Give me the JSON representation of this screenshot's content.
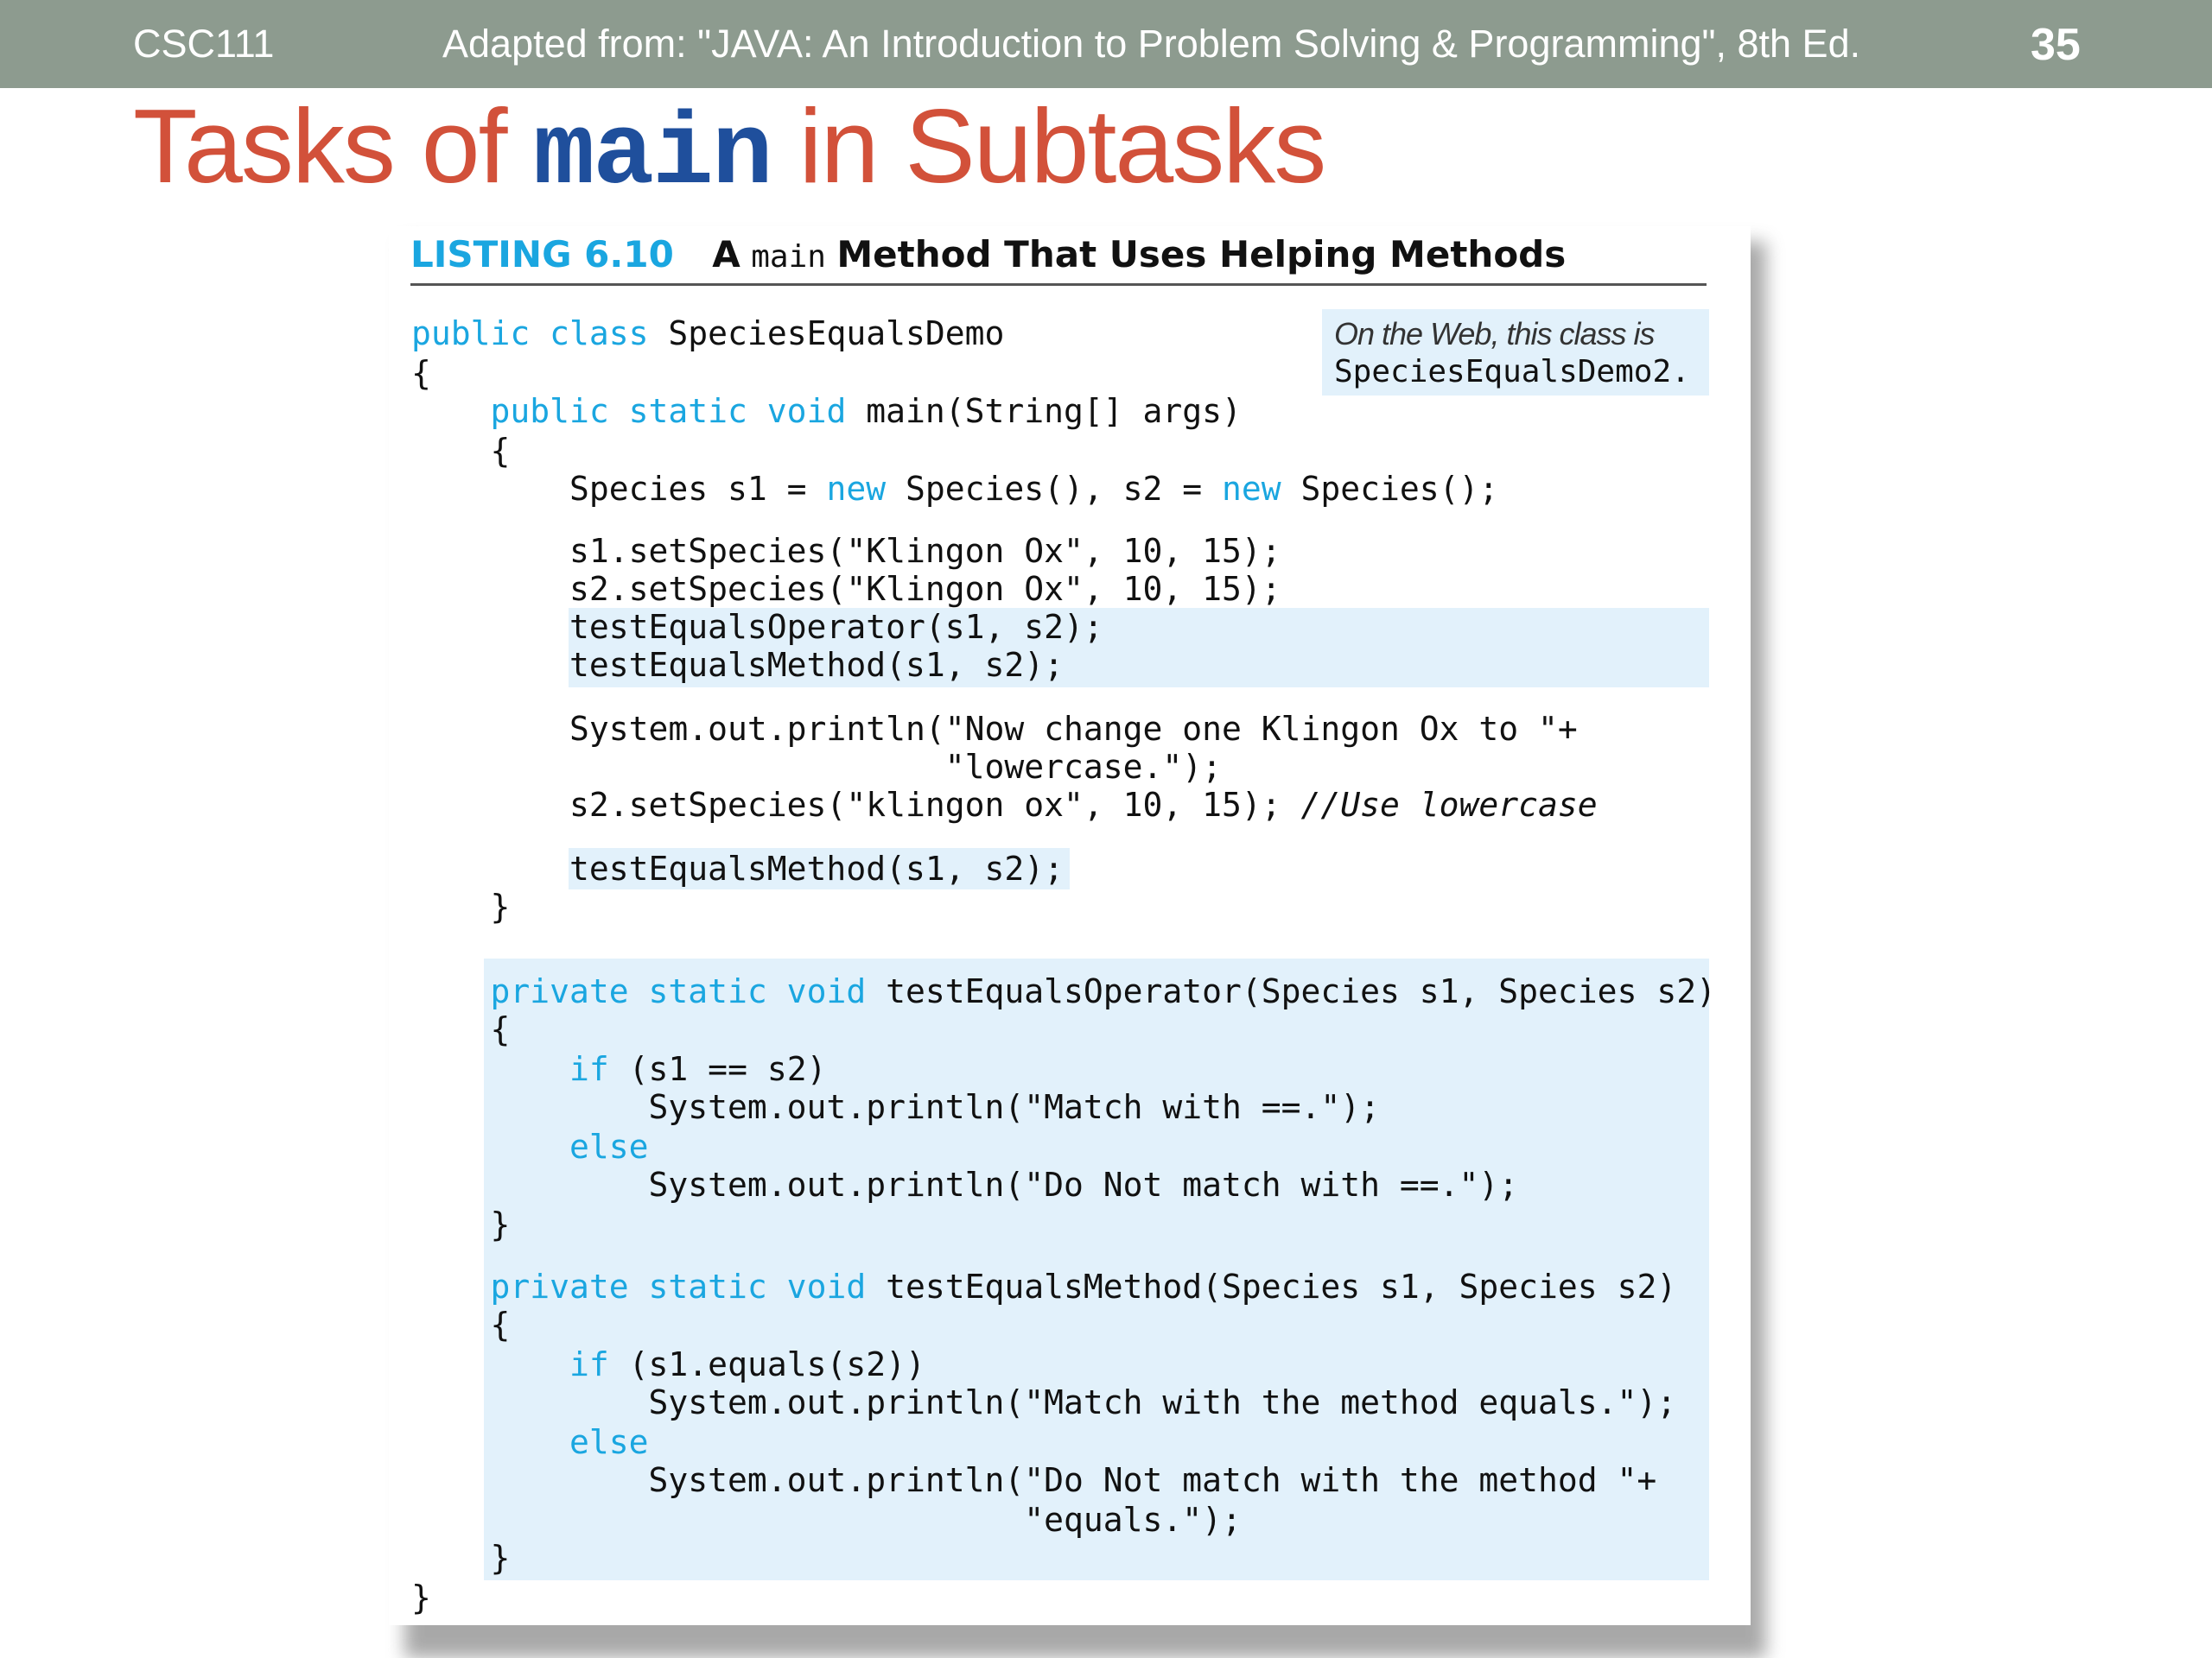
{
  "header": {
    "course": "CSC111",
    "source": "Adapted from: \"JAVA: An Introduction to Problem Solving & Programming\", 8th Ed.",
    "page_number": "35"
  },
  "title": {
    "prefix": "Tasks of ",
    "code_word": "main",
    "suffix": " in Subtasks"
  },
  "listing": {
    "label": "LISTING 6.10",
    "caption_a": "A",
    "caption_code": "main",
    "caption_b": "Method That Uses Helping Methods",
    "web_note_text": "On the Web, this class is",
    "web_note_class": "SpeciesEqualsDemo2.",
    "code_lines": [
      [
        {
          "t": "public class",
          "k": true
        },
        {
          "t": " SpeciesEqualsDemo"
        }
      ],
      [
        {
          "t": "{"
        }
      ],
      [
        {
          "t": "    "
        },
        {
          "t": "public static void",
          "k": true
        },
        {
          "t": " main(String[] args)"
        }
      ],
      [
        {
          "t": "    {"
        }
      ],
      [
        {
          "t": "        Species s1 = "
        },
        {
          "t": "new",
          "k": true
        },
        {
          "t": " Species(), s2 = "
        },
        {
          "t": "new",
          "k": true
        },
        {
          "t": " Species();"
        }
      ],
      [
        {
          "t": "        s1.setSpecies(\"Klingon Ox\", 10, 15);"
        }
      ],
      [
        {
          "t": "        s2.setSpecies(\"Klingon Ox\", 10, 15);"
        }
      ],
      [
        {
          "t": "        testEqualsOperator(s1, s2);"
        }
      ],
      [
        {
          "t": "        testEqualsMethod(s1, s2);"
        }
      ],
      [
        {
          "t": "        System.out.println(\"Now change one Klingon Ox to \"+"
        }
      ],
      [
        {
          "t": "                           \"lowercase.\");"
        }
      ],
      [
        {
          "t": "        s2.setSpecies(\"klingon ox\", 10, 15); "
        },
        {
          "t": "//Use lowercase",
          "c": true
        }
      ],
      [
        {
          "t": "        testEqualsMethod(s1, s2);"
        }
      ],
      [
        {
          "t": "    }"
        }
      ],
      [
        {
          "t": "    "
        },
        {
          "t": "private static void",
          "k": true
        },
        {
          "t": " testEqualsOperator(Species s1, Species s2)"
        }
      ],
      [
        {
          "t": "    {"
        }
      ],
      [
        {
          "t": "        "
        },
        {
          "t": "if",
          "k": true
        },
        {
          "t": " (s1 == s2)"
        }
      ],
      [
        {
          "t": "            System.out.println(\"Match with ==.\");"
        }
      ],
      [
        {
          "t": "        "
        },
        {
          "t": "else",
          "k": true
        }
      ],
      [
        {
          "t": "            System.out.println(\"Do Not match with ==.\");"
        }
      ],
      [
        {
          "t": "    }"
        }
      ],
      [
        {
          "t": "    "
        },
        {
          "t": "private static void",
          "k": true
        },
        {
          "t": " testEqualsMethod(Species s1, Species s2)"
        }
      ],
      [
        {
          "t": "    {"
        }
      ],
      [
        {
          "t": "        "
        },
        {
          "t": "if",
          "k": true
        },
        {
          "t": " (s1.equals(s2))"
        }
      ],
      [
        {
          "t": "            System.out.println(\"Match with the method equals.\");"
        }
      ],
      [
        {
          "t": "        "
        },
        {
          "t": "else",
          "k": true
        }
      ],
      [
        {
          "t": "            System.out.println(\"Do Not match with the method \"+"
        }
      ],
      [
        {
          "t": "                               \"equals.\");"
        }
      ],
      [
        {
          "t": "    }"
        }
      ],
      [
        {
          "t": "}"
        }
      ]
    ]
  }
}
